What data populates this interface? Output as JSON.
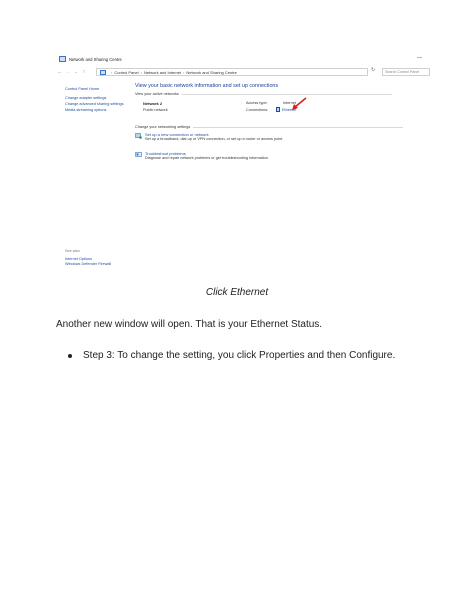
{
  "window": {
    "title": "Network and Sharing Centre",
    "minimize": "—",
    "nav": {
      "back": "←",
      "forward": "→",
      "down": "⌄",
      "up": "↑",
      "refresh": "↻"
    },
    "breadcrumbs": [
      "Control Panel",
      "Network and Internet",
      "Network and Sharing Centre"
    ],
    "search_placeholder": "Search Control Panel"
  },
  "left_nav": {
    "items": [
      "Control Panel Home",
      "Change adapter settings",
      "Change advanced sharing settings",
      "Media streaming options"
    ]
  },
  "see_also": {
    "heading": "See also",
    "links": [
      "Internet Options",
      "Windows Defender Firewall"
    ]
  },
  "main": {
    "heading": "View your basic network information and set up connections",
    "active_networks_label": "View your active networks",
    "network": {
      "name": "Network 2",
      "type": "Public network",
      "access_type_label": "Access type:",
      "access_type_value": "Internet",
      "connections_label": "Connections:",
      "connections_value": "Ethernet"
    },
    "change_settings_label": "Change your networking settings",
    "tasks": [
      {
        "link": "Set up a new connection or network",
        "desc": "Set up a broadband, dial-up or VPN connection, or set up a router or access point."
      },
      {
        "link": "Troubleshoot problems",
        "desc": "Diagnose and repair network problems or get troubleshooting information."
      }
    ]
  },
  "document": {
    "caption": "Click Ethernet",
    "paragraph": "Another new window will open. That is your Ethernet Status.",
    "bullet": "Step 3: To change the setting, you click Properties and then Configure."
  },
  "colors": {
    "link": "#1a4fa0",
    "heading": "#1c3e94",
    "arrow": "#d42020"
  }
}
